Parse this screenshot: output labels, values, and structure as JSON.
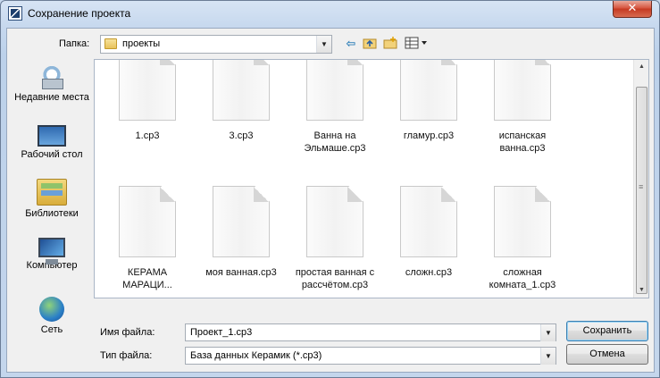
{
  "window": {
    "title": "Сохранение проекта",
    "close_symbol": "✕"
  },
  "location": {
    "label": "Папка:",
    "value": "проекты",
    "dropdown_icon": "chevron-down-icon"
  },
  "toolbar": {
    "back_icon": "back-arrow-icon",
    "up_icon": "up-folder-icon",
    "new_folder_icon": "new-folder-icon",
    "view_icon": "view-menu-icon"
  },
  "places": [
    {
      "label": "Недавние места",
      "icon": "recent-places-icon"
    },
    {
      "label": "Рабочий стол",
      "icon": "desktop-icon"
    },
    {
      "label": "Библиотеки",
      "icon": "libraries-icon"
    },
    {
      "label": "Компьютер",
      "icon": "computer-icon"
    },
    {
      "label": "Сеть",
      "icon": "network-icon"
    }
  ],
  "files": [
    {
      "name": "1.ср3"
    },
    {
      "name": "3.ср3"
    },
    {
      "name": "Ванна на Эльмаше.ср3"
    },
    {
      "name": "гламур.ср3"
    },
    {
      "name": "испанская ванна.ср3"
    },
    {
      "name": "КЕРАМА МАРАЦИ..."
    },
    {
      "name": "моя ванная.ср3"
    },
    {
      "name": "простая ванная с рассчётом.ср3"
    },
    {
      "name": "сложн.ср3"
    },
    {
      "name": "сложная комната_1.ср3"
    }
  ],
  "form": {
    "filename_label": "Имя файла:",
    "filename_value": "Проект_1.ср3",
    "filetype_label": "Тип файла:",
    "filetype_value": "База данных Керамик (*.ср3)"
  },
  "buttons": {
    "save": "Сохранить",
    "cancel": "Отмена"
  }
}
